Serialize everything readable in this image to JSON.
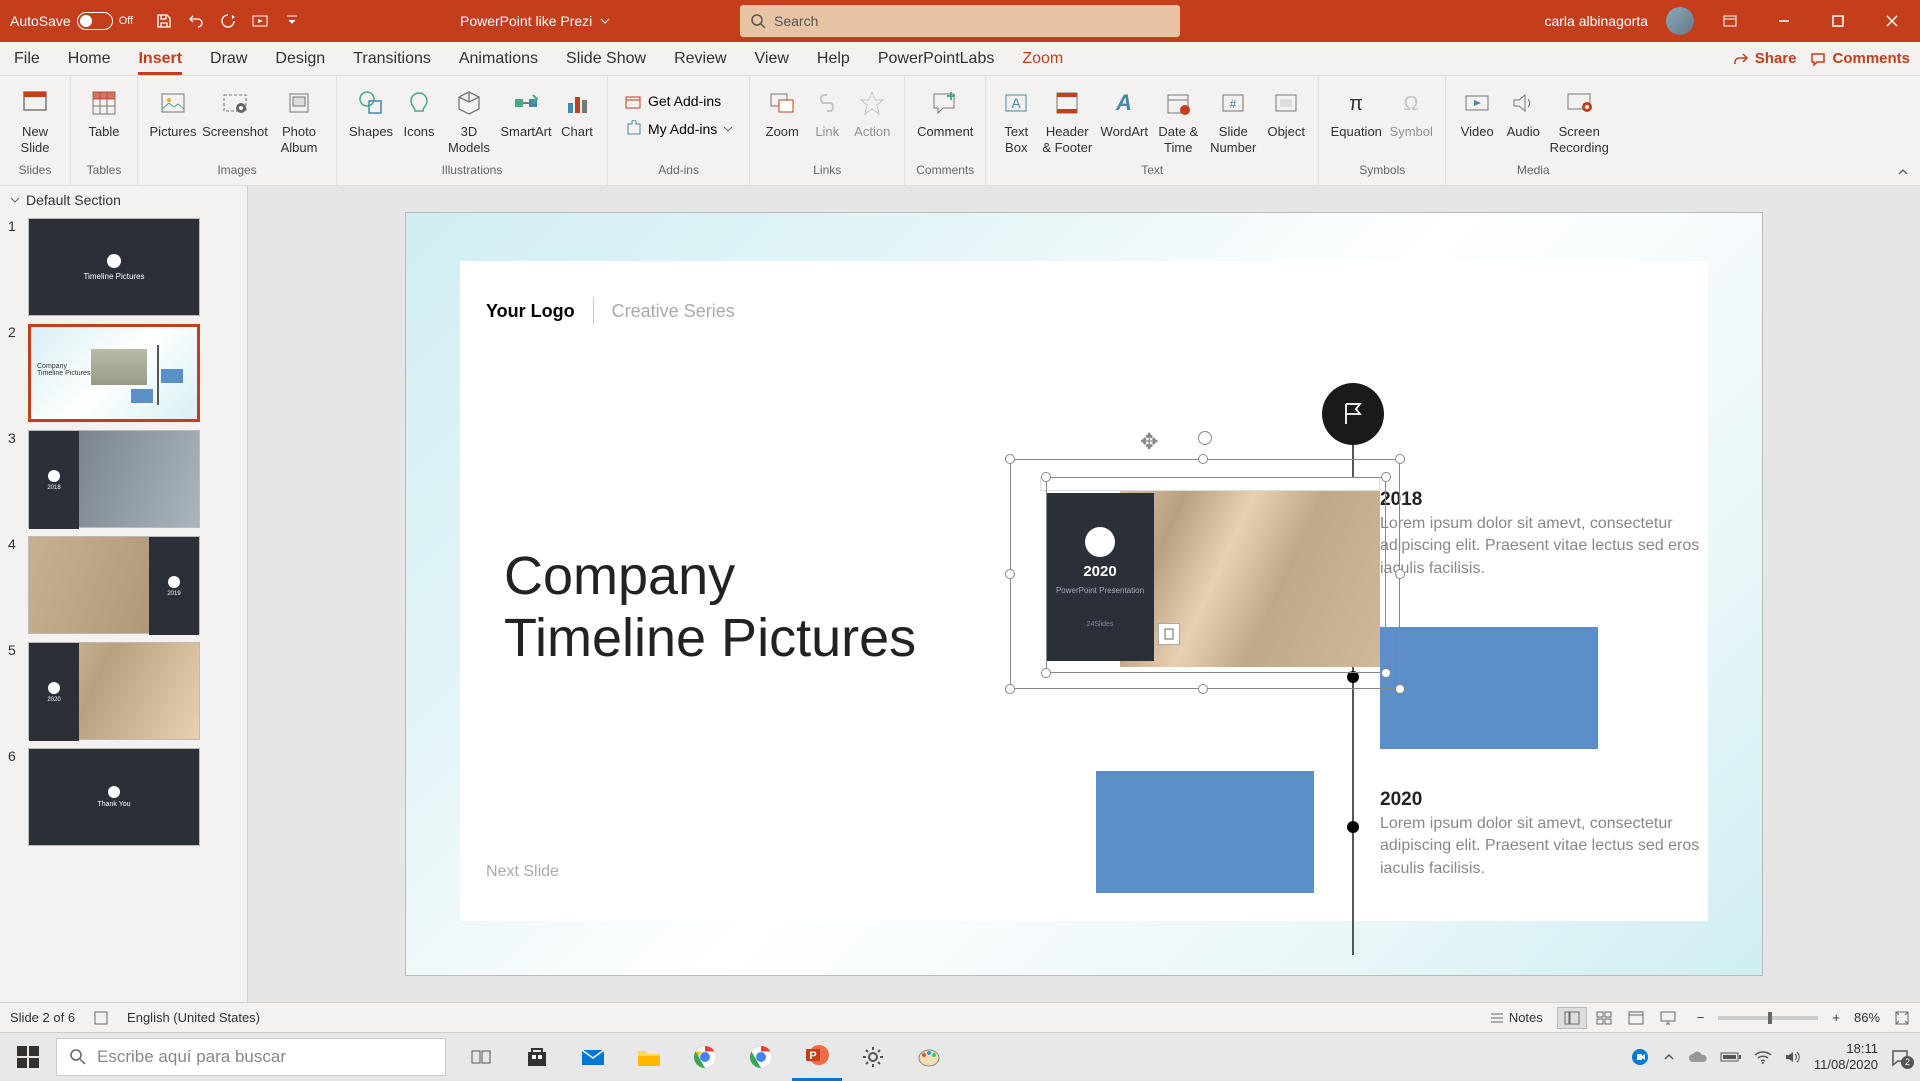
{
  "titlebar": {
    "autosave_label": "AutoSave",
    "autosave_state": "Off",
    "doc_title": "PowerPoint like Prezi",
    "search_placeholder": "Search",
    "user_name": "carla albinagorta"
  },
  "tabs": {
    "file": "File",
    "home": "Home",
    "insert": "Insert",
    "draw": "Draw",
    "design": "Design",
    "transitions": "Transitions",
    "animations": "Animations",
    "slideshow": "Slide Show",
    "review": "Review",
    "view": "View",
    "help": "Help",
    "pptlabs": "PowerPointLabs",
    "zoom": "Zoom",
    "share": "Share",
    "comments": "Comments"
  },
  "ribbon": {
    "new_slide": "New\nSlide",
    "table": "Table",
    "pictures": "Pictures",
    "screenshot": "Screenshot",
    "photo_album": "Photo\nAlbum",
    "shapes": "Shapes",
    "icons": "Icons",
    "models": "3D\nModels",
    "smartart": "SmartArt",
    "chart": "Chart",
    "get_addins": "Get Add-ins",
    "my_addins": "My Add-ins",
    "zoom": "Zoom",
    "link": "Link",
    "action": "Action",
    "comment": "Comment",
    "textbox": "Text\nBox",
    "headerfooter": "Header\n& Footer",
    "wordart": "WordArt",
    "datetime": "Date &\nTime",
    "slidenum": "Slide\nNumber",
    "object": "Object",
    "equation": "Equation",
    "symbol": "Symbol",
    "video": "Video",
    "audio": "Audio",
    "screenrec": "Screen\nRecording",
    "groups": {
      "slides": "Slides",
      "tables": "Tables",
      "images": "Images",
      "illustrations": "Illustrations",
      "addins": "Add-ins",
      "links": "Links",
      "comments": "Comments",
      "text": "Text",
      "symbols": "Symbols",
      "media": "Media"
    }
  },
  "thumbs": {
    "section": "Default Section",
    "count": 6
  },
  "slide": {
    "logo": "Your Logo",
    "series": "Creative Series",
    "title_l1": "Company",
    "title_l2": "Timeline Pictures",
    "next": "Next Slide",
    "card_year": "2020",
    "card_sub": "PowerPoint Presentation",
    "card_brand": "24Slides",
    "y1": "2018",
    "y2": "2020",
    "desc1": "Lorem ipsum dolor sit amevt, consectetur adipiscing elit. Praesent vitae lectus sed eros iaculis facilisis.",
    "desc2": "Lorem ipsum dolor sit amevt, consectetur adipiscing elit. Praesent vitae lectus sed eros iaculis facilisis."
  },
  "status": {
    "slide_pos": "Slide 2 of 6",
    "lang": "English (United States)",
    "notes": "Notes",
    "zoom": "86%"
  },
  "taskbar": {
    "search_placeholder": "Escribe aquí para buscar",
    "time": "18:11",
    "date": "11/08/2020",
    "notif": "2"
  }
}
